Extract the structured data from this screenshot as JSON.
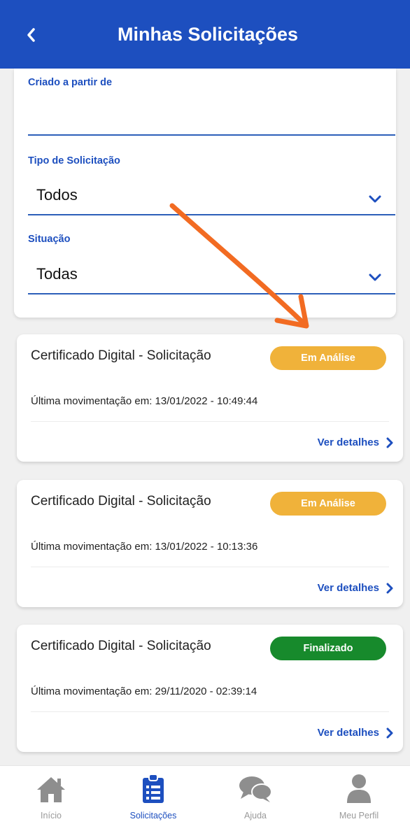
{
  "header": {
    "title": "Minhas Solicitações",
    "back_icon": "chevron-left-icon"
  },
  "filters": {
    "created_from": {
      "label": "Criado a partir de",
      "value": "",
      "placeholder": ""
    },
    "request_type": {
      "label": "Tipo de Solicitação",
      "value": "Todos"
    },
    "status": {
      "label": "Situação",
      "value": "Todas"
    }
  },
  "requests": [
    {
      "title": "Certificado Digital - Solicitação",
      "status": "Em Análise",
      "status_color": "#f0b23a",
      "last_move": "Última movimentação em: 13/01/2022 - 10:49:44",
      "link": "Ver detalhes"
    },
    {
      "title": "Certificado Digital - Solicitação",
      "status": "Em Análise",
      "status_color": "#f0b23a",
      "last_move": "Última movimentação em: 13/01/2022 - 10:13:36",
      "link": "Ver detalhes"
    },
    {
      "title": "Certificado Digital - Solicitação",
      "status": "Finalizado",
      "status_color": "#178a2c",
      "last_move": "Última movimentação em: 29/11/2020 - 02:39:14",
      "link": "Ver detalhes"
    }
  ],
  "annotation": {
    "color": "#f26b22"
  },
  "bottom_nav": {
    "items": [
      {
        "label": "Início",
        "icon": "home-icon"
      },
      {
        "label": "Solicitações",
        "icon": "clipboard-list-icon",
        "active": true
      },
      {
        "label": "Ajuda",
        "icon": "chat-bubbles-icon"
      },
      {
        "label": "Meu Perfil",
        "icon": "user-icon"
      }
    ]
  },
  "colors": {
    "primary": "#1d4fbf",
    "background": "#f0f0f0",
    "inactive_icon": "#8e8e8e"
  }
}
